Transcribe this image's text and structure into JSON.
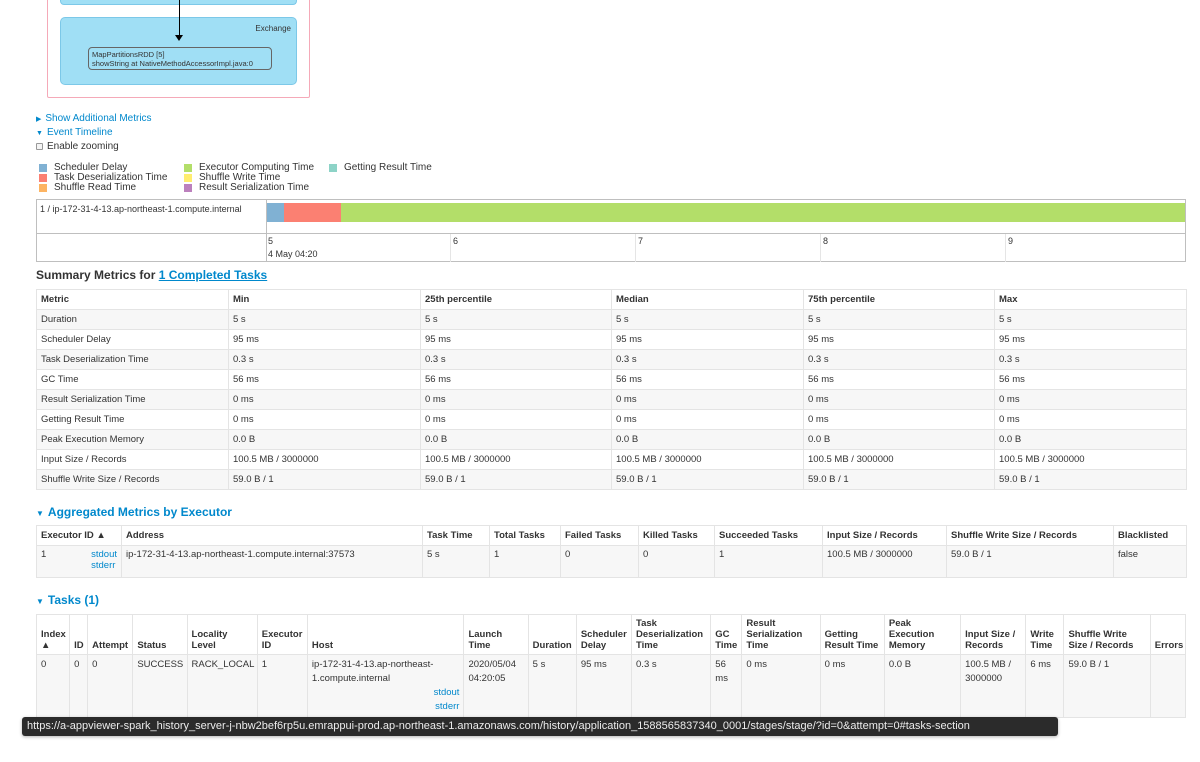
{
  "dag": {
    "exchange_label": "Exchange",
    "node_line1": "MapPartitionsRDD [5]",
    "node_line2": "showString at NativeMethodAccessorImpl.java:0"
  },
  "toggles": {
    "additional_metrics": "Show Additional Metrics",
    "event_timeline": "Event Timeline",
    "enable_zooming": "Enable zooming"
  },
  "legend": [
    {
      "label": "Scheduler Delay",
      "color": "#80b1d3"
    },
    {
      "label": "Task Deserialization Time",
      "color": "#fb8072"
    },
    {
      "label": "Shuffle Read Time",
      "color": "#fdb462"
    },
    {
      "label": "Executor Computing Time",
      "color": "#b3de69"
    },
    {
      "label": "Shuffle Write Time",
      "color": "#ffed6f"
    },
    {
      "label": "Result Serialization Time",
      "color": "#bc80bd"
    },
    {
      "label": "Getting Result Time",
      "color": "#8dd3c7"
    }
  ],
  "timeline": {
    "executor_label": "1 / ip-172-31-4-13.ap-northeast-1.compute.internal",
    "ticks": [
      "5",
      "6",
      "7",
      "8",
      "9"
    ],
    "date_label": "4 May 04:20",
    "segments": [
      {
        "name": "scheduler-delay",
        "color": "#80b1d3",
        "fraction": 0.019
      },
      {
        "name": "task-deserialization",
        "color": "#fb8072",
        "fraction": 0.062
      },
      {
        "name": "executor-computing",
        "color": "#b3de69",
        "fraction": 0.919
      }
    ]
  },
  "summary": {
    "title_prefix": "Summary Metrics for ",
    "title_link": "1 Completed Tasks",
    "headers": [
      "Metric",
      "Min",
      "25th percentile",
      "Median",
      "75th percentile",
      "Max"
    ],
    "rows": [
      [
        "Duration",
        "5 s",
        "5 s",
        "5 s",
        "5 s",
        "5 s"
      ],
      [
        "Scheduler Delay",
        "95 ms",
        "95 ms",
        "95 ms",
        "95 ms",
        "95 ms"
      ],
      [
        "Task Deserialization Time",
        "0.3 s",
        "0.3 s",
        "0.3 s",
        "0.3 s",
        "0.3 s"
      ],
      [
        "GC Time",
        "56 ms",
        "56 ms",
        "56 ms",
        "56 ms",
        "56 ms"
      ],
      [
        "Result Serialization Time",
        "0 ms",
        "0 ms",
        "0 ms",
        "0 ms",
        "0 ms"
      ],
      [
        "Getting Result Time",
        "0 ms",
        "0 ms",
        "0 ms",
        "0 ms",
        "0 ms"
      ],
      [
        "Peak Execution Memory",
        "0.0 B",
        "0.0 B",
        "0.0 B",
        "0.0 B",
        "0.0 B"
      ],
      [
        "Input Size / Records",
        "100.5 MB / 3000000",
        "100.5 MB / 3000000",
        "100.5 MB / 3000000",
        "100.5 MB / 3000000",
        "100.5 MB / 3000000"
      ],
      [
        "Shuffle Write Size / Records",
        "59.0 B / 1",
        "59.0 B / 1",
        "59.0 B / 1",
        "59.0 B / 1",
        "59.0 B / 1"
      ]
    ]
  },
  "aggregated": {
    "title": "Aggregated Metrics by Executor",
    "headers": [
      "Executor ID ▲",
      "Address",
      "Task Time",
      "Total Tasks",
      "Failed Tasks",
      "Killed Tasks",
      "Succeeded Tasks",
      "Input Size / Records",
      "Shuffle Write Size / Records",
      "Blacklisted"
    ],
    "row": {
      "executor_id": "1",
      "stdout": "stdout",
      "stderr": "stderr",
      "address": "ip-172-31-4-13.ap-northeast-1.compute.internal:37573",
      "task_time": "5 s",
      "total_tasks": "1",
      "failed_tasks": "0",
      "killed_tasks": "0",
      "succeeded_tasks": "1",
      "input": "100.5 MB / 3000000",
      "shuffle_write": "59.0 B / 1",
      "blacklisted": "false"
    }
  },
  "tasks": {
    "title": "Tasks (1)",
    "headers": [
      "Index ▲",
      "ID",
      "Attempt",
      "Status",
      "Locality Level",
      "Executor ID",
      "Host",
      "Launch Time",
      "Duration",
      "Scheduler Delay",
      "Task Deserialization Time",
      "GC Time",
      "Result Serialization Time",
      "Getting Result Time",
      "Peak Execution Memory",
      "Input Size / Records",
      "Write Time",
      "Shuffle Write Size / Records",
      "Errors"
    ],
    "row": {
      "index": "0",
      "id": "0",
      "attempt": "0",
      "status": "SUCCESS",
      "locality": "RACK_LOCAL",
      "executor_id": "1",
      "host": "ip-172-31-4-13.ap-northeast-1.compute.internal",
      "stdout": "stdout",
      "stderr": "stderr",
      "launch_time": "2020/05/04 04:20:05",
      "duration": "5 s",
      "scheduler_delay": "95 ms",
      "task_deser": "0.3 s",
      "gc_time": "56 ms",
      "result_ser": "0 ms",
      "getting_result": "0 ms",
      "peak_mem": "0.0 B",
      "input": "100.5 MB / 3000000",
      "write_time": "6 ms",
      "shuffle_write": "59.0 B / 1",
      "errors": ""
    }
  },
  "status_url": "https://a-appviewer-spark_history_server-j-nbw2bef6rp5u.emrappui-prod.ap-northeast-1.amazonaws.com/history/application_1588565837340_0001/stages/stage/?id=0&attempt=0#tasks-section"
}
